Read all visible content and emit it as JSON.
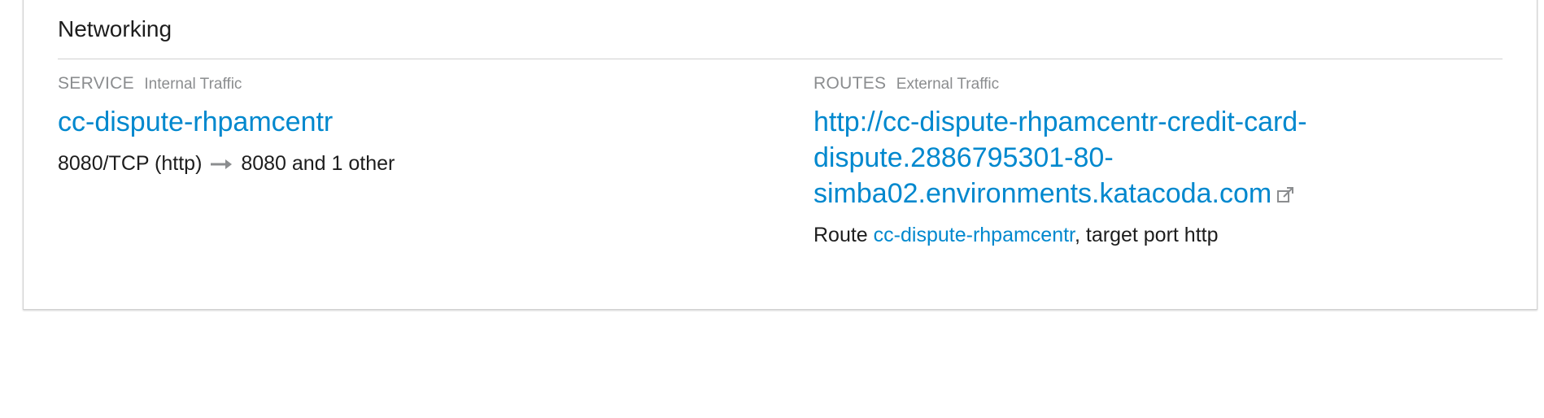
{
  "networking": {
    "title": "Networking",
    "service": {
      "label": "SERVICE",
      "sublabel": "Internal Traffic",
      "name": "cc-dispute-rhpamcentr",
      "port_from": "8080/TCP (http)",
      "port_to": "8080 and 1 other"
    },
    "routes": {
      "label": "ROUTES",
      "sublabel": "External Traffic",
      "url": "http://cc-dispute-rhpamcentr-credit-card-dispute.2886795301-80-simba02.environments.katacoda.com",
      "route_prefix": "Route ",
      "route_name": "cc-dispute-rhpamcentr",
      "route_suffix": ", target port http"
    }
  },
  "icons": {
    "arrow": "arrow-right-icon",
    "external": "external-link-icon"
  },
  "colors": {
    "link": "#0088ce",
    "muted": "#8b8d8f",
    "text": "#1d1d1d",
    "border": "#d1d1d1"
  }
}
